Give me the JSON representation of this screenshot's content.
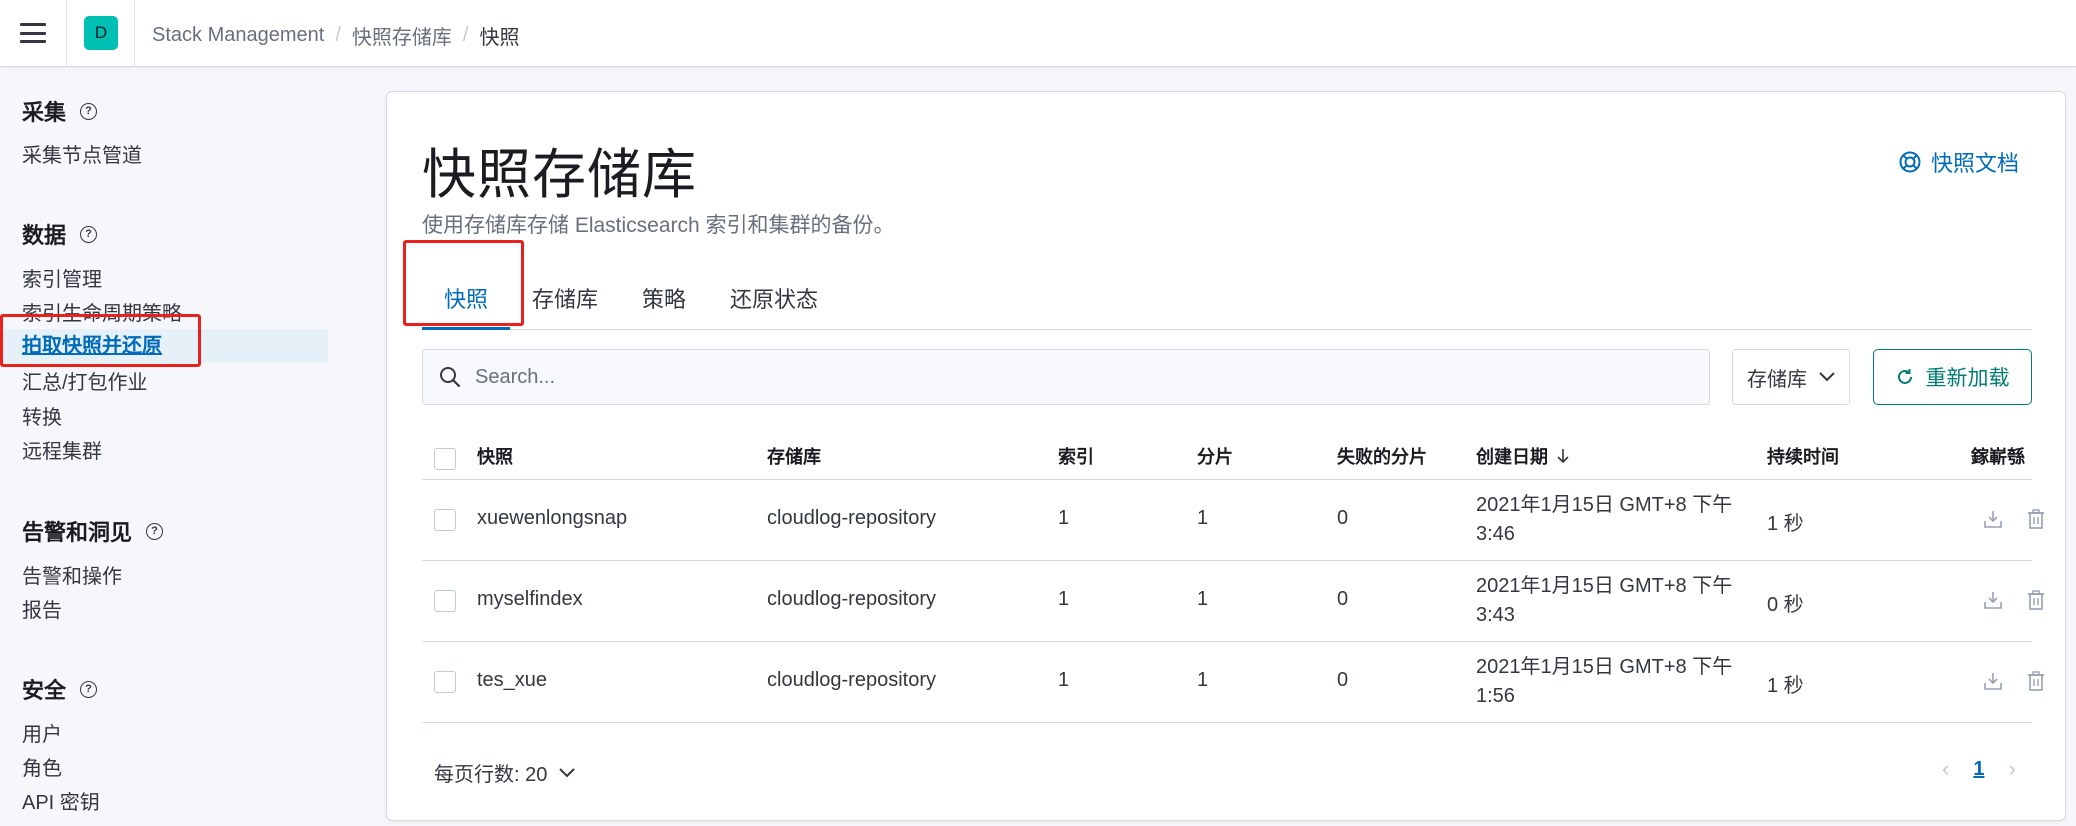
{
  "header": {
    "avatar_letter": "D",
    "breadcrumbs": [
      "Stack Management",
      "快照存储库",
      "快照"
    ]
  },
  "sidebar": {
    "groups": [
      {
        "title": "采集",
        "items": [
          "采集节点管道"
        ]
      },
      {
        "title": "数据",
        "items": [
          "索引管理",
          "索引生命周期策略",
          "拍取快照并还原",
          "汇总/打包作业",
          "转换",
          "远程集群"
        ]
      },
      {
        "title": "告警和洞见",
        "items": [
          "告警和操作",
          "报告"
        ]
      },
      {
        "title": "安全",
        "items": [
          "用户",
          "角色",
          "API 密钥"
        ]
      }
    ],
    "active_item": "拍取快照并还原"
  },
  "main": {
    "title": "快照存储库",
    "subtitle": "使用存储库存储 Elasticsearch 索引和集群的备份。",
    "doc_link": "快照文档",
    "tabs": [
      "快照",
      "存储库",
      "策略",
      "还原状态"
    ],
    "active_tab": "快照",
    "search": {
      "placeholder": "Search..."
    },
    "repo_filter_label": "存储库",
    "reload_label": "重新加载",
    "table": {
      "columns": [
        "快照",
        "存储库",
        "索引",
        "分片",
        "失败的分片",
        "创建日期",
        "持续时间",
        "鎵嶄綔"
      ],
      "rows": [
        {
          "snapshot": "xuewenlongsnap",
          "repository": "cloudlog-repository",
          "indices": "1",
          "shards": "1",
          "failed": "0",
          "date": "2021年1月15日 GMT+8 下午 3:46",
          "duration": "1 秒"
        },
        {
          "snapshot": "myselfindex",
          "repository": "cloudlog-repository",
          "indices": "1",
          "shards": "1",
          "failed": "0",
          "date": "2021年1月15日 GMT+8 下午 3:43",
          "duration": "0 秒"
        },
        {
          "snapshot": "tes_xue",
          "repository": "cloudlog-repository",
          "indices": "1",
          "shards": "1",
          "failed": "0",
          "date": "2021年1月15日 GMT+8 下午 1:56",
          "duration": "1 秒"
        }
      ]
    },
    "pagination": {
      "rows_per_page": "每页行数: 20",
      "current_page": "1"
    }
  },
  "colors": {
    "accent": "#006bb8",
    "reload": "#017d73",
    "highlight_box": "#e8211d",
    "avatar": "#00bfb3"
  }
}
